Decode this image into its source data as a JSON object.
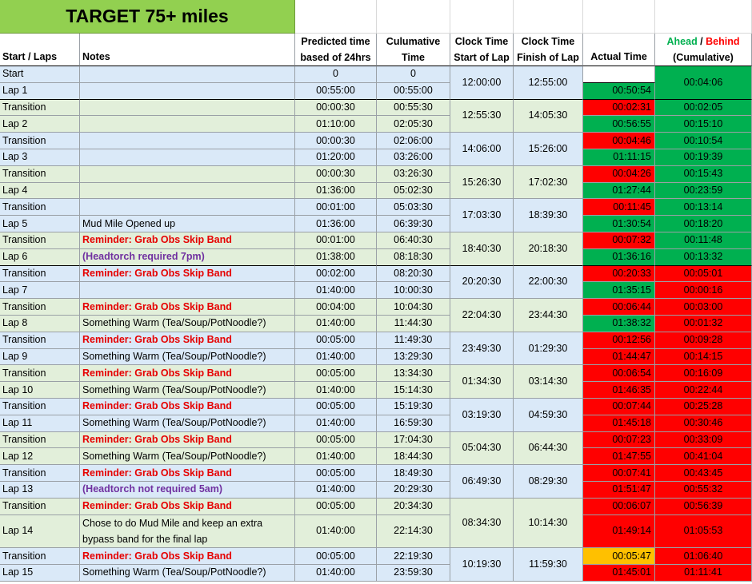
{
  "title": "TARGET 75+ miles",
  "headers": {
    "laps": "Start / Laps",
    "notes": "Notes",
    "predicted": "Predicted time based of 24hrs",
    "cumulative": "Culumative Time",
    "clock_start": "Clock Time Start of Lap",
    "clock_finish": "Clock Time Finish of Lap",
    "actual": "Actual Time",
    "ahead": "Ahead",
    "slash": " / ",
    "behind": "Behind",
    "cumulative_paren": "(Cumulative)"
  },
  "colors": {
    "title_bg": "#92d050",
    "blue_band": "#dae9f8",
    "green_band": "#e2efda",
    "good": "#00b050",
    "bad": "#ff0000",
    "warn": "#ffc000",
    "ahead_text": "#00b050",
    "behind_text": "#ff0000",
    "reminder_text": "#e60000",
    "headtorch_text": "#7030a0"
  },
  "rows": [
    {
      "lap": "Start",
      "note": "",
      "predicted": "0",
      "cum": "0",
      "actual": "",
      "diff": ""
    },
    {
      "lap": "Lap 1",
      "note": "",
      "predicted": "00:55:00",
      "cum": "00:55:00",
      "actual": "00:50:54",
      "actual_status": "good",
      "diff": "00:04:06",
      "diff_status": "good"
    },
    {
      "lap": "Transition",
      "note": "",
      "predicted": "00:00:30",
      "cum": "00:55:30",
      "actual": "00:02:31",
      "actual_status": "bad",
      "diff": "00:02:05",
      "diff_status": "good"
    },
    {
      "lap": "Lap 2",
      "note": "",
      "predicted": "01:10:00",
      "cum": "02:05:30",
      "actual": "00:56:55",
      "actual_status": "good",
      "diff": "00:15:10",
      "diff_status": "good"
    },
    {
      "lap": "Transition",
      "note": "",
      "predicted": "00:00:30",
      "cum": "02:06:00",
      "actual": "00:04:46",
      "actual_status": "bad",
      "diff": "00:10:54",
      "diff_status": "good"
    },
    {
      "lap": "Lap 3",
      "note": "",
      "predicted": "01:20:00",
      "cum": "03:26:00",
      "actual": "01:11:15",
      "actual_status": "good",
      "diff": "00:19:39",
      "diff_status": "good"
    },
    {
      "lap": "Transition",
      "note": "",
      "predicted": "00:00:30",
      "cum": "03:26:30",
      "actual": "00:04:26",
      "actual_status": "bad",
      "diff": "00:15:43",
      "diff_status": "good"
    },
    {
      "lap": "Lap 4",
      "note": "",
      "predicted": "01:36:00",
      "cum": "05:02:30",
      "actual": "01:27:44",
      "actual_status": "good",
      "diff": "00:23:59",
      "diff_status": "good"
    },
    {
      "lap": "Transition",
      "note": "",
      "predicted": "00:01:00",
      "cum": "05:03:30",
      "actual": "00:11:45",
      "actual_status": "bad",
      "diff": "00:13:14",
      "diff_status": "good"
    },
    {
      "lap": "Lap 5",
      "note": "Mud Mile Opened up",
      "predicted": "01:36:00",
      "cum": "06:39:30",
      "actual": "01:30:54",
      "actual_status": "good",
      "diff": "00:18:20",
      "diff_status": "good"
    },
    {
      "lap": "Transition",
      "note": "Reminder: Grab Obs Skip Band",
      "note_style": "reminder",
      "predicted": "00:01:00",
      "cum": "06:40:30",
      "actual": "00:07:32",
      "actual_status": "bad",
      "diff": "00:11:48",
      "diff_status": "good"
    },
    {
      "lap": "Lap 6",
      "note": "(Headtorch required 7pm)",
      "note_style": "headtorch",
      "predicted": "01:38:00",
      "cum": "08:18:30",
      "actual": "01:36:16",
      "actual_status": "good",
      "diff": "00:13:32",
      "diff_status": "good"
    },
    {
      "lap": "Transition",
      "note": "Reminder: Grab Obs Skip Band",
      "note_style": "reminder",
      "predicted": "00:02:00",
      "cum": "08:20:30",
      "actual": "00:20:33",
      "actual_status": "bad",
      "diff": "00:05:01",
      "diff_status": "bad"
    },
    {
      "lap": "Lap 7",
      "note": "",
      "predicted": "01:40:00",
      "cum": "10:00:30",
      "actual": "01:35:15",
      "actual_status": "good",
      "diff": "00:00:16",
      "diff_status": "bad"
    },
    {
      "lap": "Transition",
      "note": "Reminder: Grab Obs Skip Band",
      "note_style": "reminder",
      "predicted": "00:04:00",
      "cum": "10:04:30",
      "actual": "00:06:44",
      "actual_status": "bad",
      "diff": "00:03:00",
      "diff_status": "bad"
    },
    {
      "lap": "Lap 8",
      "note": "Something Warm (Tea/Soup/PotNoodle?)",
      "predicted": "01:40:00",
      "cum": "11:44:30",
      "actual": "01:38:32",
      "actual_status": "good",
      "diff": "00:01:32",
      "diff_status": "bad"
    },
    {
      "lap": "Transition",
      "note": "Reminder: Grab Obs Skip Band",
      "note_style": "reminder",
      "predicted": "00:05:00",
      "cum": "11:49:30",
      "actual": "00:12:56",
      "actual_status": "bad",
      "diff": "00:09:28",
      "diff_status": "bad"
    },
    {
      "lap": "Lap 9",
      "note": "Something Warm (Tea/Soup/PotNoodle?)",
      "predicted": "01:40:00",
      "cum": "13:29:30",
      "actual": "01:44:47",
      "actual_status": "bad",
      "diff": "00:14:15",
      "diff_status": "bad"
    },
    {
      "lap": "Transition",
      "note": "Reminder: Grab Obs Skip Band",
      "note_style": "reminder",
      "predicted": "00:05:00",
      "cum": "13:34:30",
      "actual": "00:06:54",
      "actual_status": "bad",
      "diff": "00:16:09",
      "diff_status": "bad"
    },
    {
      "lap": "Lap 10",
      "note": "Something Warm (Tea/Soup/PotNoodle?)",
      "predicted": "01:40:00",
      "cum": "15:14:30",
      "actual": "01:46:35",
      "actual_status": "bad",
      "diff": "00:22:44",
      "diff_status": "bad"
    },
    {
      "lap": "Transition",
      "note": "Reminder: Grab Obs Skip Band",
      "note_style": "reminder",
      "predicted": "00:05:00",
      "cum": "15:19:30",
      "actual": "00:07:44",
      "actual_status": "bad",
      "diff": "00:25:28",
      "diff_status": "bad"
    },
    {
      "lap": "Lap 11",
      "note": "Something Warm (Tea/Soup/PotNoodle?)",
      "predicted": "01:40:00",
      "cum": "16:59:30",
      "actual": "01:45:18",
      "actual_status": "bad",
      "diff": "00:30:46",
      "diff_status": "bad"
    },
    {
      "lap": "Transition",
      "note": "Reminder: Grab Obs Skip Band",
      "note_style": "reminder",
      "predicted": "00:05:00",
      "cum": "17:04:30",
      "actual": "00:07:23",
      "actual_status": "bad",
      "diff": "00:33:09",
      "diff_status": "bad"
    },
    {
      "lap": "Lap 12",
      "note": "Something Warm (Tea/Soup/PotNoodle?)",
      "predicted": "01:40:00",
      "cum": "18:44:30",
      "actual": "01:47:55",
      "actual_status": "bad",
      "diff": "00:41:04",
      "diff_status": "bad"
    },
    {
      "lap": "Transition",
      "note": "Reminder: Grab Obs Skip Band",
      "note_style": "reminder",
      "predicted": "00:05:00",
      "cum": "18:49:30",
      "actual": "00:07:41",
      "actual_status": "bad",
      "diff": "00:43:45",
      "diff_status": "bad"
    },
    {
      "lap": "Lap 13",
      "note": "(Headtorch not required 5am)",
      "note_style": "headtorch",
      "predicted": "01:40:00",
      "cum": "20:29:30",
      "actual": "01:51:47",
      "actual_status": "bad",
      "diff": "00:55:32",
      "diff_status": "bad"
    },
    {
      "lap": "Transition",
      "note": "Reminder: Grab Obs Skip Band",
      "note_style": "reminder",
      "predicted": "00:05:00",
      "cum": "20:34:30",
      "actual": "00:06:07",
      "actual_status": "bad",
      "diff": "00:56:39",
      "diff_status": "bad"
    },
    {
      "lap": "Lap 14",
      "note": "Chose to do Mud Mile and keep an extra bypass band for the final lap",
      "predicted": "01:40:00",
      "cum": "22:14:30",
      "actual": "01:49:14",
      "actual_status": "bad",
      "diff": "01:05:53",
      "diff_status": "bad"
    },
    {
      "lap": "Transition",
      "note": "Reminder: Grab Obs Skip Band",
      "note_style": "reminder",
      "predicted": "00:05:00",
      "cum": "22:19:30",
      "actual": "00:05:47",
      "actual_status": "warn",
      "diff": "01:06:40",
      "diff_status": "bad"
    },
    {
      "lap": "Lap 15",
      "note": "Something Warm (Tea/Soup/PotNoodle?)",
      "predicted": "01:40:00",
      "cum": "23:59:30",
      "actual": "01:45:01",
      "actual_status": "bad",
      "diff": "01:11:41",
      "diff_status": "bad"
    }
  ],
  "clock_pairs": [
    {
      "start": "12:00:00",
      "finish": "12:55:00"
    },
    {
      "start": "12:55:30",
      "finish": "14:05:30"
    },
    {
      "start": "14:06:00",
      "finish": "15:26:00"
    },
    {
      "start": "15:26:30",
      "finish": "17:02:30"
    },
    {
      "start": "17:03:30",
      "finish": "18:39:30"
    },
    {
      "start": "18:40:30",
      "finish": "20:18:30"
    },
    {
      "start": "20:20:30",
      "finish": "22:00:30"
    },
    {
      "start": "22:04:30",
      "finish": "23:44:30"
    },
    {
      "start": "23:49:30",
      "finish": "01:29:30"
    },
    {
      "start": "01:34:30",
      "finish": "03:14:30"
    },
    {
      "start": "03:19:30",
      "finish": "04:59:30"
    },
    {
      "start": "05:04:30",
      "finish": "06:44:30"
    },
    {
      "start": "06:49:30",
      "finish": "08:29:30"
    },
    {
      "start": "08:34:30",
      "finish": "10:14:30"
    },
    {
      "start": "10:19:30",
      "finish": "11:59:30"
    }
  ]
}
